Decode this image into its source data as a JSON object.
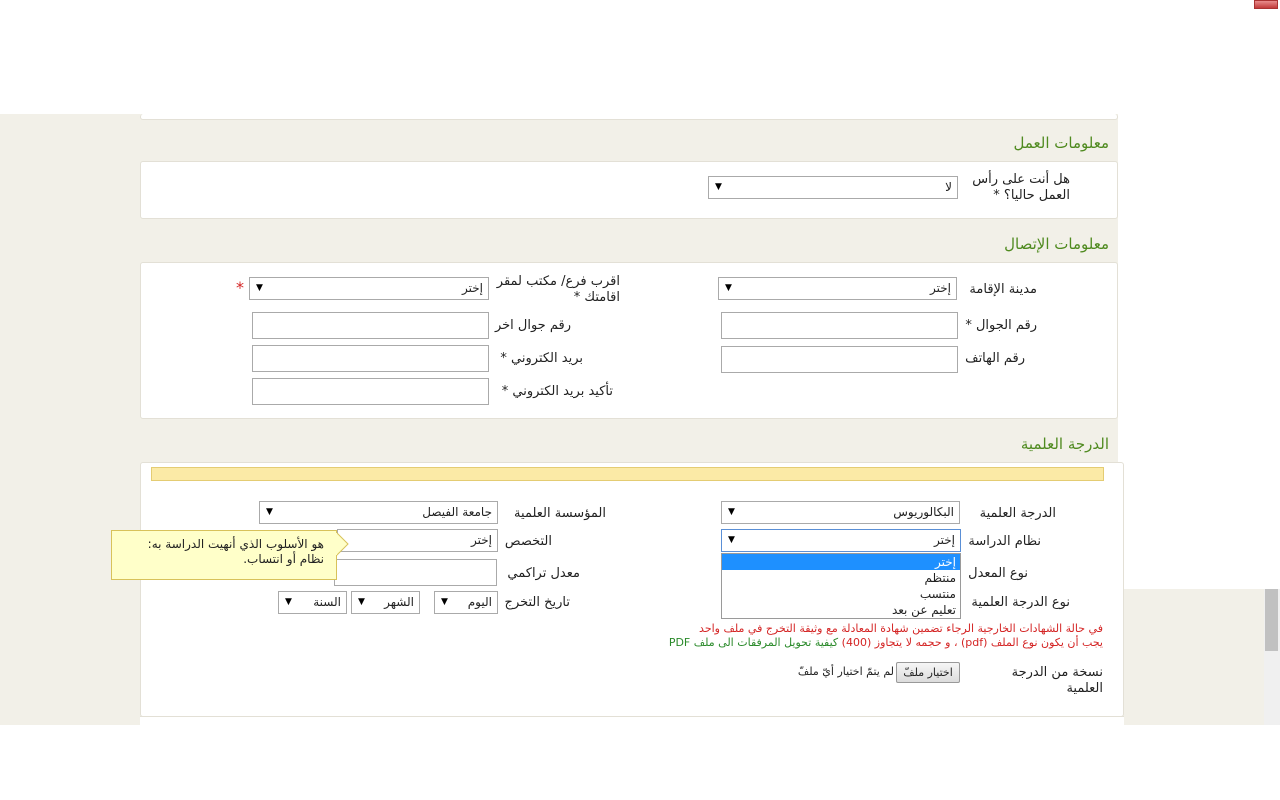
{
  "work_section": {
    "title": "معلومات العمل",
    "on_job_label": "هل أنت على رأس العمل حاليا؟ *",
    "on_job_value": "لا"
  },
  "contact_section": {
    "title": "معلومات الإتصال",
    "city_label": "مدينة الإقامة",
    "city_value": "إختر",
    "branch_label": "اقرب فرع/ مكتب لمقر اقامتك *",
    "branch_value": "إختر",
    "branch_required_mark": "*",
    "mobile_label": "رقم الجوال *",
    "mobile_value": "",
    "alt_mobile_label": "رقم جوال اخر",
    "alt_mobile_value": "",
    "phone_label": "رقم الهاتف",
    "phone_value": "",
    "email_label": "بريد الكتروني *",
    "email_value": "",
    "email_confirm_label": "تأكيد بريد الكتروني *",
    "email_confirm_value": ""
  },
  "degree_section": {
    "title": "الدرجة العلمية",
    "degree_label": "الدرجة العلمية",
    "degree_value": "البكالوريوس",
    "institution_label": "المؤسسة العلمية",
    "institution_value": "جامعة الفيصل",
    "study_system_label": "نظام الدراسة",
    "study_system_value": "إختر",
    "study_system_options": [
      "إختر",
      "منتظم",
      "منتسب",
      "تعليم عن بعد"
    ],
    "study_system_selected_index": 0,
    "major_label": "التخصص",
    "major_value": "إختر",
    "gpa_type_label": "نوع المعدل",
    "gpa_label": "معدل تراكمي",
    "gpa_value": "",
    "degree_type_label": "نوع الدرجة العلمية",
    "grad_date_label": "تاريخ التخرج",
    "grad_day": "اليوم",
    "grad_month": "الشهر",
    "grad_year": "السنة",
    "tooltip_line1": "هو الأسلوب الذي أنهيت الدراسة به:",
    "tooltip_line2": "نظام أو انتساب.",
    "note_foreign": "في حالة الشهادات الخارجية الرجاء تضمين شهادة المعادلة مع وثيقة التخرج في ملف واحد",
    "note_pdf": "يجب أن يكون نوع الملف (pdf) ، و حجمه لا يتجاوز (400) كيفية تحويل المرفقات الى ملف PDF",
    "copy_label": "نسخة من الدرجة العلمية",
    "file_button": "اختيار ملفّ",
    "file_status": "لم يتمّ اختيار أيّ ملفّ"
  },
  "colors": {
    "section_title": "#4f8a1f",
    "required": "#d42424",
    "page_band": "#f2f0e8",
    "dropdown_highlight": "#1e90ff",
    "tooltip_bg": "#ffffc9"
  }
}
